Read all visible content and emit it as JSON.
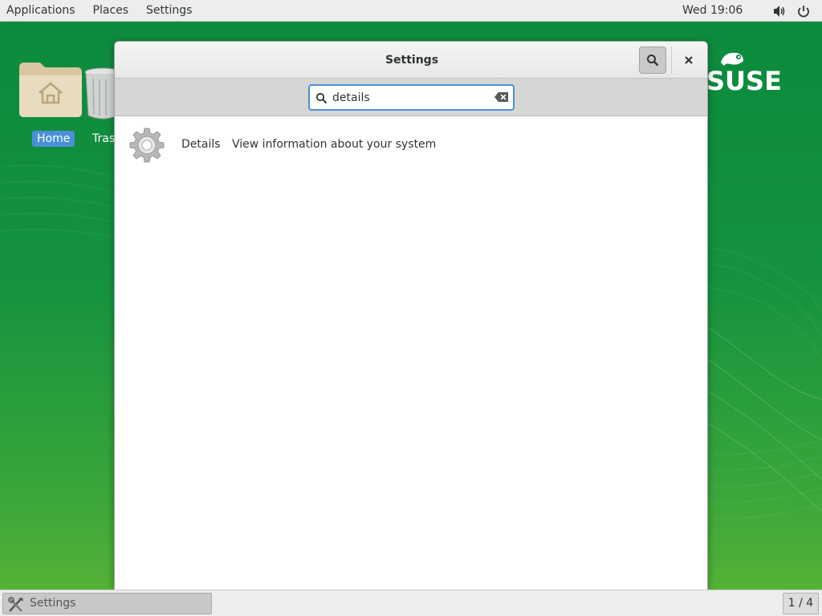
{
  "top_panel": {
    "menus": [
      "Applications",
      "Places",
      "Settings"
    ],
    "clock": "Wed 19:06",
    "volume_icon": "volume-icon",
    "power_icon": "power-icon"
  },
  "desktop": {
    "icons": [
      {
        "label": "Home",
        "icon": "home-folder-icon",
        "selected": true
      },
      {
        "label": "Tras",
        "icon": "trash-icon",
        "selected": false
      }
    ],
    "logo_text": "SUSE",
    "brand_color": "#0b8a3e"
  },
  "window": {
    "title": "Settings",
    "search_toggle_icon": "search-icon",
    "close_icon": "close-icon",
    "search": {
      "value": "details",
      "placeholder": ""
    },
    "results": [
      {
        "name": "Details",
        "description": "View information about your system",
        "icon": "gear-icon"
      }
    ]
  },
  "bottom_panel": {
    "task_label": "Settings",
    "workspace": "1 / 4"
  },
  "colors": {
    "accent": "#4a90d9"
  }
}
